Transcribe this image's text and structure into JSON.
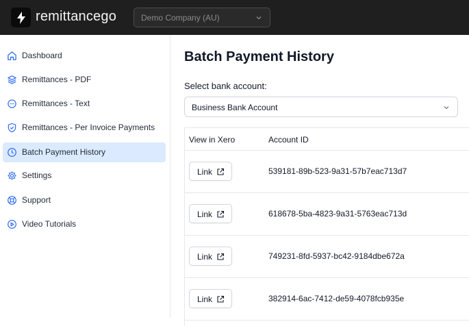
{
  "app": {
    "logo_text": "remittancego",
    "logo_icon": "lightning-bolt-icon"
  },
  "header": {
    "company_select_value": "Demo Company (AU)"
  },
  "sidebar": {
    "items": [
      {
        "label": "Dashboard",
        "icon": "home-icon"
      },
      {
        "label": "Remittances - PDF",
        "icon": "layers-icon"
      },
      {
        "label": "Remittances - Text",
        "icon": "chat-bubble-icon"
      },
      {
        "label": "Remittances - Per Invoice Payments",
        "icon": "shield-check-icon"
      },
      {
        "label": "Batch Payment History",
        "icon": "clock-icon",
        "active": true
      },
      {
        "label": "Settings",
        "icon": "gear-icon"
      },
      {
        "label": "Support",
        "icon": "lifebuoy-icon"
      },
      {
        "label": "Video Tutorials",
        "icon": "play-circle-icon"
      }
    ]
  },
  "main": {
    "title": "Batch Payment History",
    "select_label": "Select bank account:",
    "bank_select_value": "Business Bank Account",
    "table": {
      "headers": [
        "View in Xero",
        "Account ID"
      ],
      "rows": [
        {
          "link_label": "Link",
          "account_id": "539181-89b-523-9a31-57b7eac713d7"
        },
        {
          "link_label": "Link",
          "account_id": "618678-5ba-4823-9a31-5763eac713d"
        },
        {
          "link_label": "Link",
          "account_id": "749231-8fd-5937-bc42-9184dbe672a"
        },
        {
          "link_label": "Link",
          "account_id": "382914-6ac-7412-de59-4078fcb935e"
        }
      ]
    }
  },
  "colors": {
    "topbar": "#1f1f1f",
    "active_nav_bg": "#dbeafe",
    "icon_blue": "#2563eb"
  }
}
